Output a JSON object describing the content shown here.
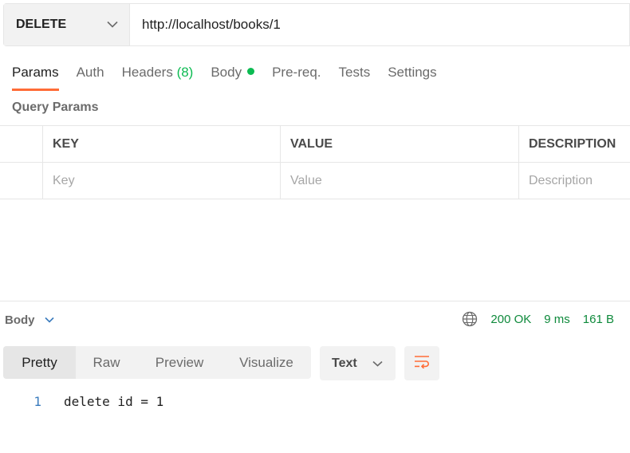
{
  "request": {
    "method": "DELETE",
    "url": "http://localhost/books/1"
  },
  "tabs": [
    {
      "label": "Params",
      "active": true
    },
    {
      "label": "Auth"
    },
    {
      "label": "Headers",
      "count": "(8)"
    },
    {
      "label": "Body",
      "indicator": "green-dot"
    },
    {
      "label": "Pre-req."
    },
    {
      "label": "Tests"
    },
    {
      "label": "Settings"
    }
  ],
  "query_params": {
    "title": "Query Params",
    "headers": [
      "KEY",
      "VALUE",
      "DESCRIPTION"
    ],
    "placeholders": [
      "Key",
      "Value",
      "Description"
    ]
  },
  "response": {
    "body_label": "Body",
    "status": "200 OK",
    "time": "9 ms",
    "size": "161 B",
    "views": [
      "Pretty",
      "Raw",
      "Preview",
      "Visualize"
    ],
    "active_view": "Pretty",
    "format": "Text",
    "lines": [
      {
        "no": "1",
        "text": "delete id = 1"
      }
    ]
  },
  "colors": {
    "accent": "#ff6c37",
    "success": "#0cbb52",
    "status_text": "#0f8a3c"
  },
  "icons": [
    "chevron-down-icon",
    "globe-icon",
    "wrap-lines-icon"
  ]
}
